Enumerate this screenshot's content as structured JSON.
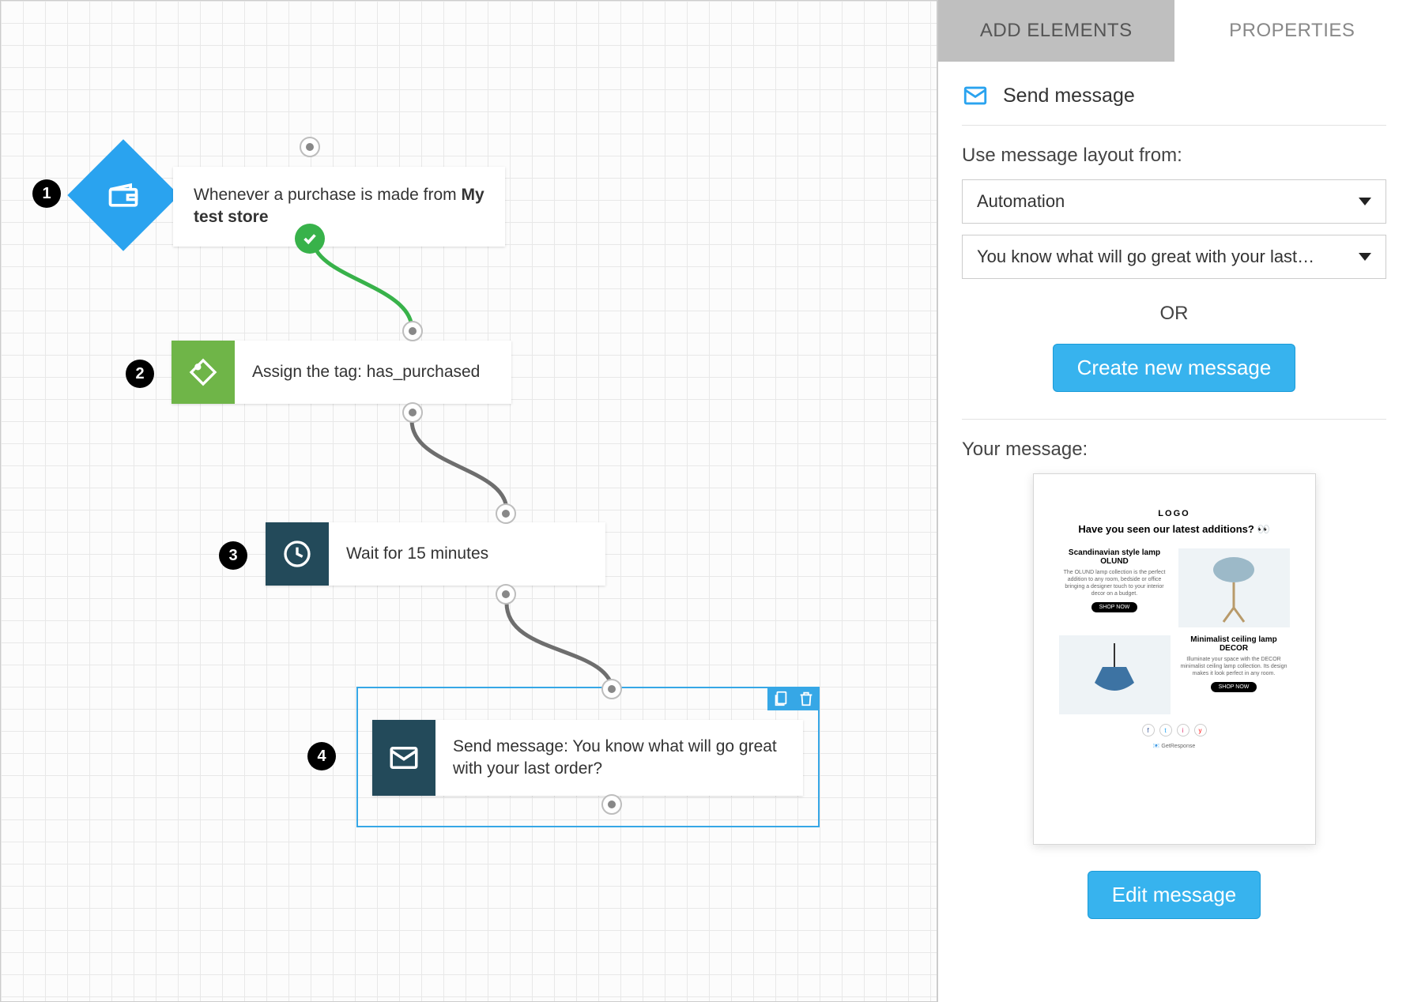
{
  "canvas": {
    "nodes": {
      "n1": {
        "num": "1",
        "text_prefix": "Whenever a purchase is made from ",
        "text_bold": "My test store"
      },
      "n2": {
        "num": "2",
        "text": "Assign the tag: has_purchased"
      },
      "n3": {
        "num": "3",
        "text": "Wait for 15 minutes"
      },
      "n4": {
        "num": "4",
        "text": "Send message: You know what will go great with your last order?"
      }
    }
  },
  "sidebar": {
    "tabs": {
      "add": "ADD ELEMENTS",
      "props": "PROPERTIES"
    },
    "panel_title": "Send message",
    "layout_label": "Use message layout from:",
    "dd1": "Automation",
    "dd2": "You know what will go great with your last…",
    "or": "OR",
    "create_btn": "Create new message",
    "your_msg": "Your message:",
    "edit_btn": "Edit message",
    "preview": {
      "logo": "LOGO",
      "headline": "Have you seen our latest additions? 👀",
      "p1_title": "Scandinavian style lamp OLUND",
      "p1_desc": "The OLUND lamp collection is the perfect addition to any room, bedside or office bringing a designer touch to your interior decor on a budget.",
      "p2_title": "Minimalist ceiling lamp DECOR",
      "p2_desc": "Illuminate your space with the DECOR minimalist ceiling lamp collection. Its design makes it look perfect in any room.",
      "shop": "SHOP NOW",
      "brand": "GetResponse"
    }
  }
}
